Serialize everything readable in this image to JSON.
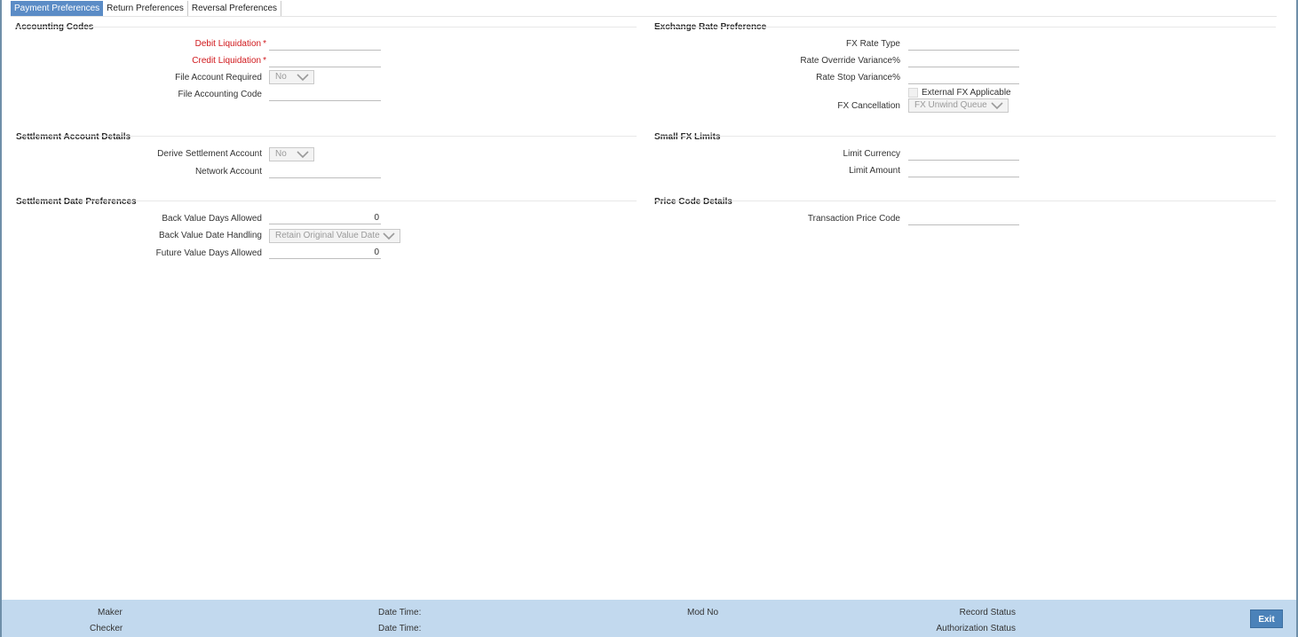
{
  "tabs": [
    "Payment Preferences",
    "Return Preferences",
    "Reversal Preferences"
  ],
  "accounting_codes": {
    "title": "Accounting Codes",
    "debit_liquidation_label": "Debit Liquidation",
    "credit_liquidation_label": "Credit Liquidation",
    "required_marker": "*",
    "file_account_required_label": "File Account Required",
    "file_account_required_value": "No",
    "file_accounting_code_label": "File Accounting Code"
  },
  "exchange_rate": {
    "title": "Exchange Rate Preference",
    "fx_rate_type_label": "FX Rate Type",
    "rate_override_label": "Rate Override Variance%",
    "rate_stop_label": "Rate Stop Variance%",
    "external_fx_label": "External FX Applicable",
    "fx_cancellation_label": "FX Cancellation",
    "fx_cancellation_value": "FX Unwind Queue"
  },
  "settlement_account": {
    "title": "Settlement Account Details",
    "derive_label": "Derive Settlement Account",
    "derive_value": "No",
    "network_account_label": "Network Account"
  },
  "small_fx": {
    "title": "Small FX Limits",
    "limit_currency_label": "Limit Currency",
    "limit_amount_label": "Limit Amount"
  },
  "settlement_date": {
    "title": "Settlement Date Preferences",
    "back_value_days_label": "Back Value Days Allowed",
    "back_value_days_value": "0",
    "back_value_handling_label": "Back Value Date Handling",
    "back_value_handling_value": "Retain Original Value Date",
    "future_value_days_label": "Future Value Days Allowed",
    "future_value_days_value": "0"
  },
  "price_code": {
    "title": "Price Code Details",
    "transaction_price_code_label": "Transaction Price Code"
  },
  "footer": {
    "maker": "Maker",
    "checker": "Checker",
    "date_time_1": "Date Time:",
    "date_time_2": "Date Time:",
    "mod_no": "Mod No",
    "record_status": "Record Status",
    "authorization_status": "Authorization Status",
    "exit": "Exit"
  },
  "colors": {
    "active_tab": "#5b8cc6",
    "required": "#d0181c",
    "footer_bg": "#c2d9ee",
    "exit_button": "#4b82b9"
  },
  "icons": {
    "select_arrow": "chevron-down-icon"
  }
}
